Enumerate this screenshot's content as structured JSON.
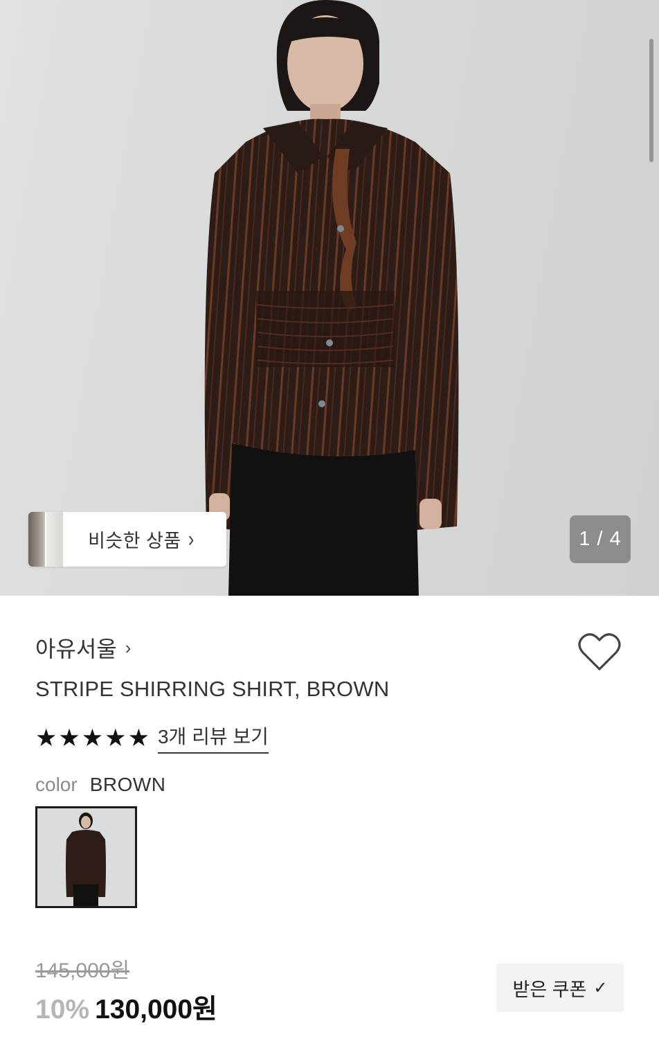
{
  "hero": {
    "similar_button_label": "비슷한 상품",
    "similar_chevron": "›",
    "image_counter": "1 / 4"
  },
  "product": {
    "brand": "아유서울",
    "brand_chevron": "›",
    "name": "STRIPE SHIRRING SHIRT, BROWN",
    "rating_stars": 5,
    "review_link": "3개 리뷰 보기",
    "color_label": "color",
    "color_value": "BROWN",
    "original_price": "145,000원",
    "discount": "10%",
    "price": "130,000원",
    "coupon_label": "받은 쿠폰",
    "coupon_check": "✓"
  },
  "icons": {
    "wishlist": "heart-outline-icon",
    "star": "star-filled-icon",
    "chevron": "chevron-right-icon",
    "check": "check-icon"
  },
  "colors": {
    "accent": "#111111",
    "muted": "#999999",
    "discount": "#b5b5b5",
    "coupon_bg": "#f2f2f2"
  }
}
